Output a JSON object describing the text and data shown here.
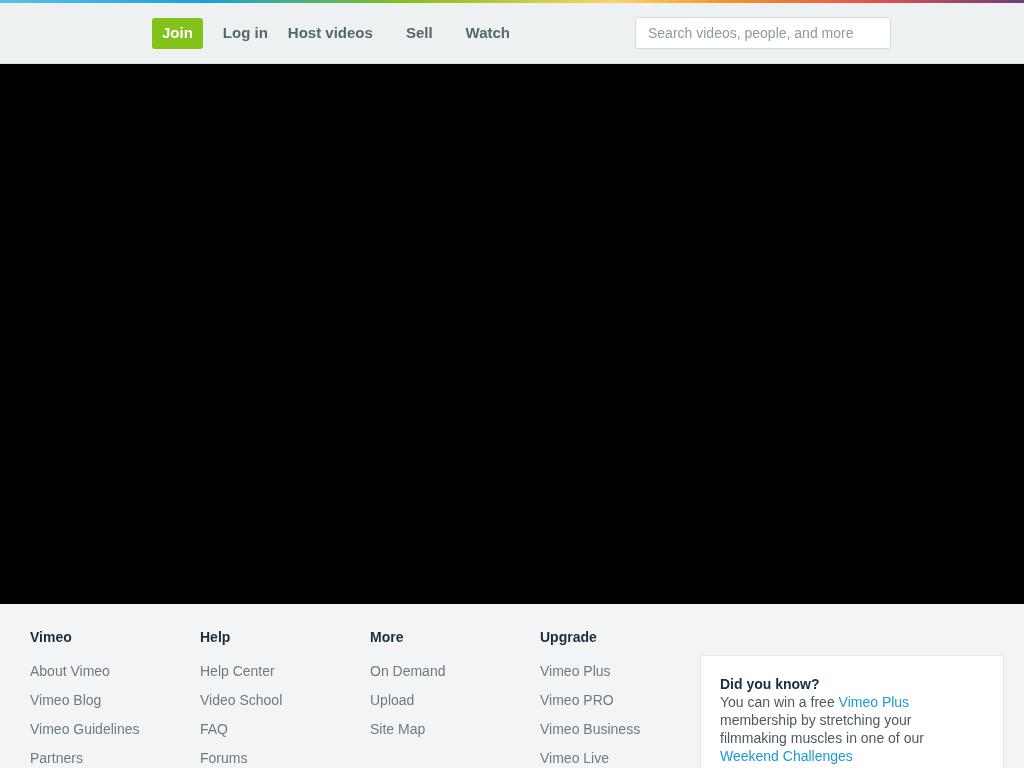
{
  "nav": {
    "join": "Join",
    "links": [
      "Log in",
      "Host videos",
      "Sell",
      "Watch"
    ],
    "search": {
      "placeholder": "Search videos, people, and more"
    }
  },
  "footer": {
    "columns": [
      {
        "heading": "Vimeo",
        "links": [
          "About Vimeo",
          "Vimeo Blog",
          "Vimeo Guidelines",
          "Partners"
        ]
      },
      {
        "heading": "Help",
        "links": [
          "Help Center",
          "Video School",
          "FAQ",
          "Forums"
        ]
      },
      {
        "heading": "More",
        "links": [
          "On Demand",
          "Upload",
          "Site Map"
        ]
      },
      {
        "heading": "Upgrade",
        "links": [
          "Vimeo Plus",
          "Vimeo PRO",
          "Vimeo Business",
          "Vimeo Live"
        ]
      }
    ],
    "did_you_know": {
      "title": "Did you know?",
      "parts": [
        {
          "kind": "text",
          "text": "You can win a free "
        },
        {
          "kind": "link",
          "text": "Vimeo Plus"
        },
        {
          "kind": "text",
          "text": " membership by stretching your filmmaking muscles in one of our "
        },
        {
          "kind": "link",
          "text": "Weekend Challenges"
        }
      ]
    }
  }
}
